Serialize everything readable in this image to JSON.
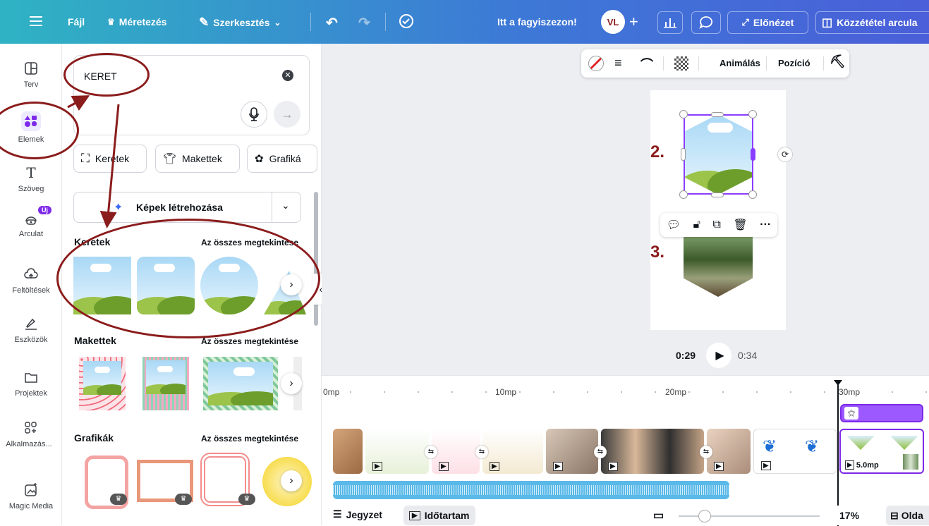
{
  "topbar": {
    "menu_label": "Fájl",
    "resize_label": "Méretezés",
    "edit_label": "Szerkesztés",
    "title": "Itt a fagyiszezon!",
    "preview_label": "Előnézet",
    "publish_label": "Közzététel arcula",
    "avatar_initials": "VL"
  },
  "sidebar": {
    "items": [
      {
        "label": "Terv"
      },
      {
        "label": "Elemek"
      },
      {
        "label": "Szöveg"
      },
      {
        "label": "Arculat",
        "badge": "Új"
      },
      {
        "label": "Feltöltések"
      },
      {
        "label": "Eszközök"
      },
      {
        "label": "Projektek"
      },
      {
        "label": "Alkalmazás..."
      },
      {
        "label": "Magic Media"
      }
    ]
  },
  "panel": {
    "search_value": "KERET",
    "chips": [
      "Keretek",
      "Makettek",
      "Grafiká"
    ],
    "generate_label": "Képek létrehozása",
    "sections": [
      {
        "title": "Keretek",
        "link": "Az összes megtekintése"
      },
      {
        "title": "Makettek",
        "link": "Az összes megtekintése"
      },
      {
        "title": "Grafikák",
        "link": "Az összes megtekintése"
      }
    ]
  },
  "canvas": {
    "toolbar": {
      "animate_label": "Animálás",
      "position_label": "Pozíció"
    },
    "annotation_2": "2.",
    "annotation_3": "3.",
    "time_current": "0:29",
    "time_total": "0:34"
  },
  "timeline": {
    "ruler": [
      "0mp",
      "10mp",
      "20mp",
      "30mp"
    ],
    "clip_duration": "5.0mp"
  },
  "bottombar": {
    "notes_label": "Jegyzet",
    "duration_label": "Időtartam",
    "zoom": "17%",
    "pages_label": "Olda"
  },
  "colors": {
    "accent": "#8b3dff",
    "annotation": "#8b1c1c"
  }
}
